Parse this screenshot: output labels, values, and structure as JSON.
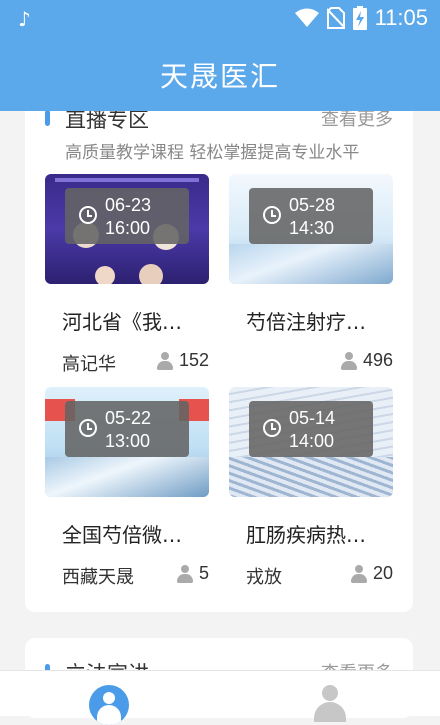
{
  "status_bar": {
    "time": "11:05",
    "app_glyph": "♪"
  },
  "header": {
    "title": "天晟医汇"
  },
  "live_section": {
    "title": "直播专区",
    "more": "查看更多",
    "subtitle": "高质量教学课程  轻松掌握提高专业水平",
    "items": [
      {
        "date": "06-23",
        "time": "16:00",
        "title": "河北省《我…",
        "author": "高记华",
        "views": "152"
      },
      {
        "date": "05-28",
        "time": "14:30",
        "title": "芍倍注射疗…",
        "author": "",
        "views": "496"
      },
      {
        "date": "05-22",
        "time": "13:00",
        "title": "全国芍倍微…",
        "author": "西藏天晟",
        "views": "5"
      },
      {
        "date": "05-14",
        "time": "14:00",
        "title": "肛肠疾病热…",
        "author": "戎放",
        "views": "20"
      }
    ]
  },
  "next_section": {
    "title": "立法宣讲",
    "more": "查看更多"
  },
  "colors": {
    "header": "#5ba8ea",
    "accent": "#4a9be8"
  }
}
